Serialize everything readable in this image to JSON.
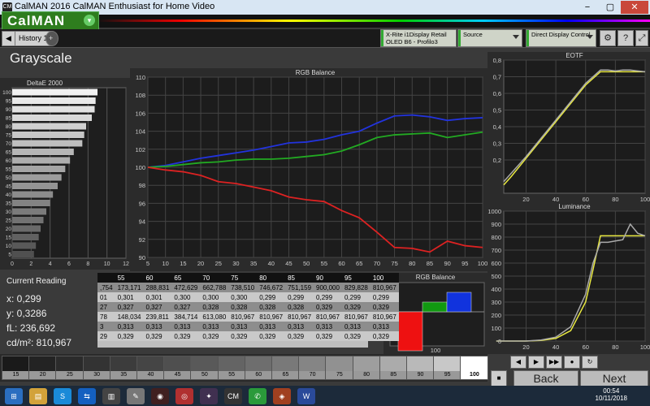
{
  "window": {
    "title": "CalMAN 2016 CalMAN Enthusiast for Home Video",
    "icon": "CM",
    "minimize": "−",
    "maximize": "▢",
    "close": "✕"
  },
  "brand": {
    "name": "CalMAN",
    "menu_arrow": "▾"
  },
  "tabs": {
    "back_arrow": "◀",
    "history_label": "History 1",
    "add_label": "+"
  },
  "toolbar": {
    "meter_line1": "X-Rite i1Display Retail",
    "meter_line2": "OLED B6 - Profilo3",
    "source_label": "Source",
    "display_label": "Direct Display Control",
    "settings_icon": "⚙",
    "help_icon": "?",
    "expand_icon": "⤢"
  },
  "page_title": "Grayscale",
  "charts": [
    {
      "type": "bar",
      "orientation": "horizontal",
      "title": "DeltaE 2000",
      "categories": [
        "5",
        "10",
        "15",
        "20",
        "25",
        "30",
        "35",
        "40",
        "45",
        "50",
        "55",
        "60",
        "65",
        "70",
        "75",
        "80",
        "85",
        "90",
        "95",
        "100"
      ],
      "values": [
        2.3,
        2.5,
        2.8,
        3.0,
        3.3,
        3.6,
        4.0,
        4.3,
        4.8,
        5.2,
        5.6,
        6.1,
        6.5,
        7.4,
        7.6,
        7.8,
        8.4,
        8.7,
        8.8,
        9.0
      ],
      "ytick_labels": [
        "5",
        "10",
        "15",
        "20",
        "25",
        "30",
        "35",
        "40",
        "45",
        "50",
        "55",
        "60",
        "65",
        "70",
        "75",
        "80",
        "85",
        "90",
        "95",
        "100"
      ],
      "xticks": [
        "0",
        "2",
        "4",
        "6",
        "8",
        "10",
        "12"
      ],
      "xlim": [
        0,
        12
      ]
    },
    {
      "type": "line",
      "title": "RGB Balance",
      "x": [
        5,
        10,
        15,
        20,
        25,
        30,
        35,
        40,
        45,
        50,
        55,
        60,
        65,
        70,
        75,
        80,
        85,
        90,
        95,
        100
      ],
      "series": [
        {
          "color": "#2233dd",
          "values": [
            100,
            100.2,
            100.6,
            101,
            101.3,
            101.6,
            101.9,
            102.3,
            102.7,
            102.8,
            103.1,
            103.6,
            104,
            104.9,
            105.7,
            105.8,
            105.6,
            105.2,
            105.4,
            105.5
          ]
        },
        {
          "color": "#22aa22",
          "values": [
            100,
            100.1,
            100.3,
            100.5,
            100.6,
            100.8,
            100.9,
            100.9,
            101,
            101.2,
            101.4,
            101.8,
            102.5,
            103.3,
            103.6,
            103.7,
            103.8,
            103.3,
            103.6,
            103.9
          ]
        },
        {
          "color": "#dd2222",
          "values": [
            100,
            99.7,
            99.5,
            99.1,
            98.4,
            98.2,
            97.8,
            97.4,
            96.7,
            96.4,
            96.2,
            95.2,
            94.4,
            92.8,
            91.1,
            91,
            90.6,
            91.8,
            91.3,
            91.1
          ]
        }
      ],
      "ylim": [
        90,
        110
      ],
      "yticks": [
        "90",
        "92",
        "94",
        "96",
        "98",
        "100",
        "102",
        "104",
        "106",
        "108",
        "110"
      ],
      "xticks": [
        "5",
        "10",
        "15",
        "20",
        "25",
        "30",
        "35",
        "40",
        "45",
        "50",
        "55",
        "60",
        "65",
        "70",
        "75",
        "80",
        "85",
        "90",
        "95",
        "100"
      ]
    },
    {
      "type": "line",
      "title": "EOTF",
      "x": [
        5,
        10,
        20,
        30,
        40,
        50,
        60,
        70,
        75,
        80,
        85,
        90,
        95,
        100
      ],
      "series": [
        {
          "color": "#e8e840",
          "values": [
            0.05,
            0.1,
            0.21,
            0.32,
            0.43,
            0.54,
            0.65,
            0.73,
            0.73,
            0.73,
            0.73,
            0.73,
            0.73,
            0.73
          ]
        },
        {
          "color": "#aaaaaa",
          "values": [
            0.07,
            0.12,
            0.22,
            0.33,
            0.44,
            0.55,
            0.66,
            0.74,
            0.74,
            0.735,
            0.74,
            0.74,
            0.735,
            0.73
          ]
        }
      ],
      "ylim": [
        0,
        0.8
      ],
      "yticks": [
        "0,2",
        "0,3",
        "0,4",
        "0,5",
        "0,6",
        "0,7",
        "0,8"
      ],
      "xticks": [
        "20",
        "40",
        "60",
        "80",
        "100"
      ]
    },
    {
      "type": "line",
      "title": "Luminance",
      "x": [
        0,
        10,
        20,
        30,
        40,
        50,
        60,
        65,
        70,
        75,
        80,
        85,
        90,
        95,
        100
      ],
      "series": [
        {
          "color": "#e8e840",
          "values": [
            0,
            0,
            0,
            5,
            20,
            80,
            300,
            550,
            810,
            810,
            810,
            810,
            810,
            810,
            810
          ]
        },
        {
          "color": "#aaaaaa",
          "values": [
            0,
            0,
            0,
            8,
            30,
            110,
            360,
            600,
            760,
            760,
            770,
            780,
            900,
            830,
            810
          ]
        }
      ],
      "ylim": [
        0,
        1000
      ],
      "yticks": [
        "0",
        "100",
        "200",
        "300",
        "400",
        "500",
        "600",
        "700",
        "800",
        "900",
        "1000"
      ],
      "xticks": [
        "20",
        "40",
        "60",
        "80",
        "100"
      ]
    },
    {
      "type": "bar",
      "title": "RGB Balance",
      "categories": [
        "R",
        "G",
        "B"
      ],
      "values": [
        -4,
        1,
        2
      ],
      "colors": [
        "#ee1111",
        "#119911",
        "#1133dd"
      ],
      "xlabel_value": "100"
    }
  ],
  "reading": {
    "heading": "Current Reading",
    "x": "x: 0,299",
    "y": "y: 0,3286",
    "fl": "fL: 236,692",
    "cdm": "cd/m²: 810,967"
  },
  "table": {
    "headers": [
      "",
      "55",
      "60",
      "65",
      "70",
      "75",
      "80",
      "85",
      "90",
      "95",
      "100"
    ],
    "rows": [
      [
        ",754",
        "173,171",
        "288,831",
        "472,629",
        "662,788",
        "738,510",
        "746,672",
        "751,159",
        "900,000",
        "829,828",
        "810,967"
      ],
      [
        "01",
        "0,301",
        "0,301",
        "0,300",
        "0,300",
        "0,300",
        "0,299",
        "0,299",
        "0,299",
        "0,299",
        "0,299"
      ],
      [
        "27",
        "0,327",
        "0,327",
        "0,327",
        "0,328",
        "0,328",
        "0,328",
        "0,328",
        "0,329",
        "0,329",
        "0,329"
      ],
      [
        "78",
        "148,034",
        "239,811",
        "384,714",
        "613,080",
        "810,967",
        "810,967",
        "810,967",
        "810,967",
        "810,967",
        "810,967"
      ],
      [
        "3",
        "0,313",
        "0,313",
        "0,313",
        "0,313",
        "0,313",
        "0,313",
        "0,313",
        "0,313",
        "0,313",
        "0,313"
      ],
      [
        "29",
        "0,329",
        "0,329",
        "0,329",
        "0,329",
        "0,329",
        "0,329",
        "0,329",
        "0,329",
        "0,329",
        "0,329"
      ]
    ]
  },
  "swatches": [
    {
      "label": "15",
      "shade": "#1a1a1a"
    },
    {
      "label": "20",
      "shade": "#232323"
    },
    {
      "label": "25",
      "shade": "#2b2b2b"
    },
    {
      "label": "30",
      "shade": "#333"
    },
    {
      "label": "35",
      "shade": "#3c3c3c"
    },
    {
      "label": "40",
      "shade": "#454545"
    },
    {
      "label": "45",
      "shade": "#4f4f4f"
    },
    {
      "label": "50",
      "shade": "#595959"
    },
    {
      "label": "55",
      "shade": "#646464"
    },
    {
      "label": "60",
      "shade": "#6e6e6e"
    },
    {
      "label": "65",
      "shade": "#797979"
    },
    {
      "label": "70",
      "shade": "#858585"
    },
    {
      "label": "75",
      "shade": "#919191"
    },
    {
      "label": "80",
      "shade": "#9e9e9e"
    },
    {
      "label": "85",
      "shade": "#ababab"
    },
    {
      "label": "90",
      "shade": "#b9b9b9"
    },
    {
      "label": "95",
      "shade": "#c8c8c8"
    },
    {
      "label": "100",
      "shade": "#ffffff"
    }
  ],
  "controls": {
    "back": "Back",
    "next": "Next",
    "stop": "■",
    "play": "▶",
    "prev": "◀",
    "skip": "▶▶",
    "repeat": "↻",
    "record": "●"
  },
  "taskbar": {
    "icons": [
      {
        "name": "start",
        "glyph": "⊞",
        "color": "#2a6ec0"
      },
      {
        "name": "explorer",
        "glyph": "▤",
        "color": "#d2a23a"
      },
      {
        "name": "skype",
        "glyph": "S",
        "color": "#1a8ad8"
      },
      {
        "name": "teamviewer",
        "glyph": "⇆",
        "color": "#1460c0"
      },
      {
        "name": "app",
        "glyph": "▥",
        "color": "#444"
      },
      {
        "name": "paint",
        "glyph": "✎",
        "color": "#777"
      },
      {
        "name": "media",
        "glyph": "◉",
        "color": "#402020"
      },
      {
        "name": "chrome",
        "glyph": "◎",
        "color": "#b03030"
      },
      {
        "name": "app2",
        "glyph": "✦",
        "color": "#403050"
      },
      {
        "name": "calman",
        "glyph": "CM",
        "color": "#333"
      },
      {
        "name": "whatsapp",
        "glyph": "✆",
        "color": "#2a9a3a"
      },
      {
        "name": "app3",
        "glyph": "◈",
        "color": "#a04020"
      },
      {
        "name": "word",
        "glyph": "W",
        "color": "#2a4a9a"
      }
    ],
    "time": "00:54",
    "date": "10/11/2018"
  }
}
